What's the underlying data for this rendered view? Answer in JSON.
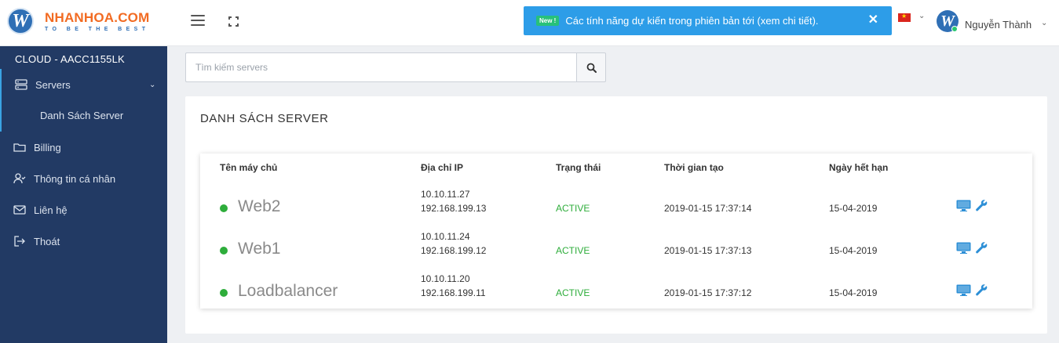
{
  "brand": {
    "logo_letter": "W",
    "name": "NHANHOA.COM",
    "tagline": "TO BE THE BEST"
  },
  "header": {
    "notice_badge": "New !",
    "notice_text": "Các tính năng dự kiến trong phiên bản tới (xem chi tiết).",
    "notice_close": "✕",
    "user_avatar_letter": "W",
    "user_name": "Nguyễn Thành",
    "colors": {
      "notice_bg": "#2d9de8",
      "badge_bg": "#27c17a"
    }
  },
  "sidebar": {
    "title": "CLOUD - AACC1155LK",
    "items": [
      {
        "label": "Servers",
        "icon": "server-icon"
      },
      {
        "label": "Danh Sách Server"
      },
      {
        "label": "Billing",
        "icon": "folder-icon"
      },
      {
        "label": "Thông tin cá nhân",
        "icon": "user-check-icon"
      },
      {
        "label": "Liên hệ",
        "icon": "envelope-icon"
      },
      {
        "label": "Thoát",
        "icon": "sign-out-icon"
      }
    ]
  },
  "search": {
    "placeholder": "Tìm kiếm servers",
    "value": ""
  },
  "server_list": {
    "title": "DANH SÁCH SERVER",
    "columns": [
      "Tên máy chủ",
      "Địa chỉ IP",
      "Trạng thái",
      "Thời gian tạo",
      "Ngày hết hạn"
    ],
    "rows": [
      {
        "name": "Web2",
        "ip_public": "10.10.11.27",
        "ip_private": "192.168.199.13",
        "status": "ACTIVE",
        "created": "2019-01-15 17:37:14",
        "expires": "15-04-2019"
      },
      {
        "name": "Web1",
        "ip_public": "10.10.11.24",
        "ip_private": "192.168.199.12",
        "status": "ACTIVE",
        "created": "2019-01-15 17:37:13",
        "expires": "15-04-2019"
      },
      {
        "name": "Loadbalancer",
        "ip_public": "10.10.11.20",
        "ip_private": "192.168.199.11",
        "status": "ACTIVE",
        "created": "2019-01-15 17:37:12",
        "expires": "15-04-2019"
      }
    ]
  }
}
